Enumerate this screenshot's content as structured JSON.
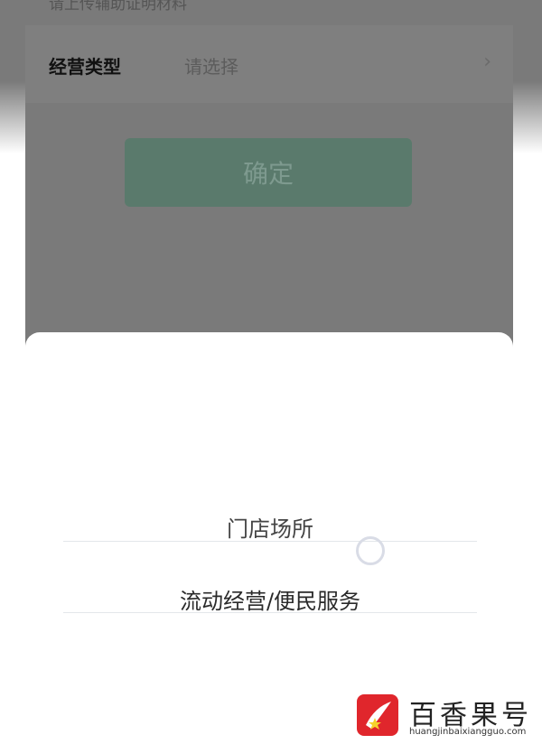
{
  "top_hint": "请上传辅助证明材料",
  "form_row": {
    "label": "经营类型",
    "value_placeholder": "请选择",
    "chevron": "›"
  },
  "confirm_button": "确定",
  "sheet": {
    "options": [
      {
        "label": "门店场所"
      },
      {
        "label": "流动经营/便民服务"
      }
    ]
  },
  "watermark": {
    "title": "百香果号",
    "url": "huangjinbaixiangguo.com"
  },
  "colors": {
    "overlay": "#7a7a7a",
    "confirm_bg": "#5a7a6c",
    "logo_red": "#e0262c"
  },
  "icons": [
    "chevron-right-icon",
    "radio-unchecked-icon",
    "logo-icon"
  ]
}
